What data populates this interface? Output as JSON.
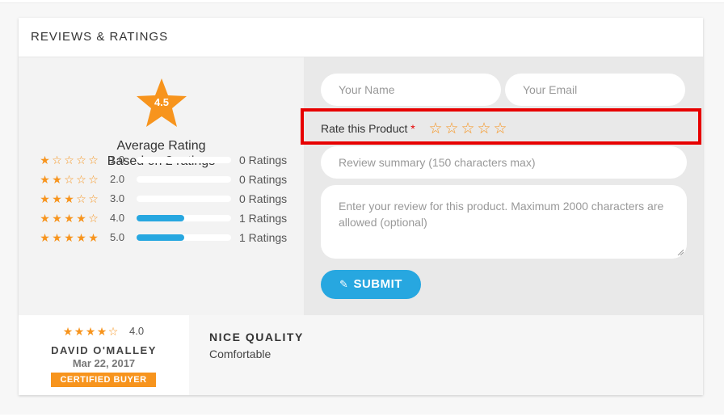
{
  "header": {
    "title": "REVIEWS & RATINGS"
  },
  "summary": {
    "average": "4.5",
    "average_label": "Average Rating",
    "based_on": "Based on 2 ratings",
    "accent_color": "#f7941d",
    "bar_color": "#27a7e0"
  },
  "breakdown": [
    {
      "stars_filled": 1,
      "value": "1.0",
      "fill": 0.0,
      "count_label": "0 Ratings"
    },
    {
      "stars_filled": 2,
      "value": "2.0",
      "fill": 0.0,
      "count_label": "0 Ratings"
    },
    {
      "stars_filled": 3,
      "value": "3.0",
      "fill": 0.0,
      "count_label": "0 Ratings"
    },
    {
      "stars_filled": 4,
      "value": "4.0",
      "fill": 0.5,
      "count_label": "1 Ratings"
    },
    {
      "stars_filled": 5,
      "value": "5.0",
      "fill": 0.5,
      "count_label": "1 Ratings"
    }
  ],
  "form": {
    "name_placeholder": "Your Name",
    "email_placeholder": "Your Email",
    "rate_label": "Rate this Product",
    "required_marker": "*",
    "rate_stars_count": 5,
    "summary_placeholder": "Review summary (150 characters max)",
    "review_placeholder": "Enter your review for this product. Maximum 2000 characters are allowed (optional)",
    "submit_label": "SUBMIT",
    "submit_icon": "edit-icon",
    "highlight_color": "#e70000"
  },
  "reviews": [
    {
      "stars_filled": 4,
      "rating": "4.0",
      "author": "DAVID O'MALLEY",
      "date": "Mar 22, 2017",
      "badge": "CERTIFIED BUYER",
      "title": "NICE QUALITY",
      "body": "Comfortable"
    }
  ]
}
